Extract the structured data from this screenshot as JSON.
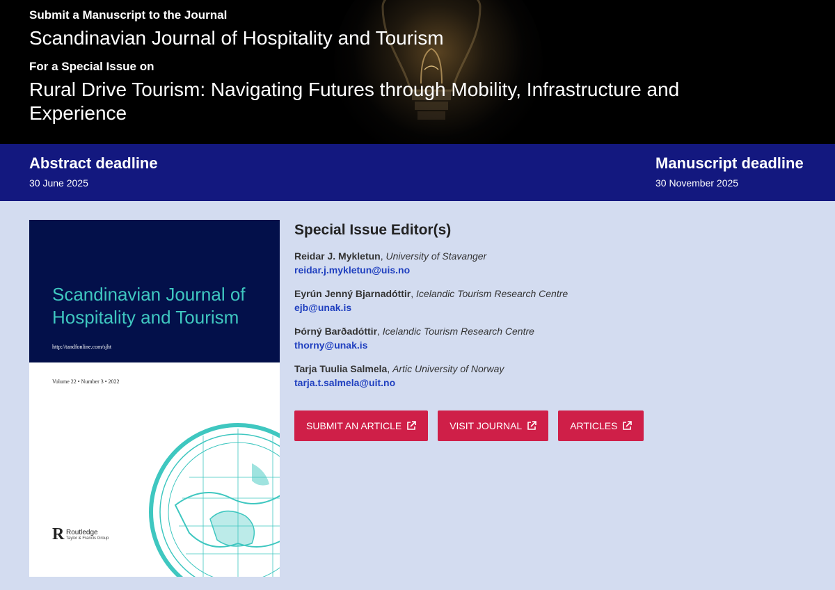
{
  "hero": {
    "kicker": "Submit a Manuscript to the Journal",
    "journal": "Scandinavian Journal of Hospitality and Tourism",
    "special_issue_label": "For a Special Issue on",
    "issue_title": "Rural Drive Tourism: Navigating Futures through Mobility, Infrastructure and Experience"
  },
  "deadlines": {
    "abstract": {
      "label": "Abstract deadline",
      "date": "30 June 2025"
    },
    "manuscript": {
      "label": "Manuscript deadline",
      "date": "30 November 2025"
    }
  },
  "cover": {
    "title": "Scandinavian Journal of Hospitality and Tourism",
    "url": "http://tandfonline.com/sjht",
    "volume": "Volume 22 • Number 3 • 2022",
    "publisher": "Routledge",
    "publisher_sub": "Taylor & Francis Group",
    "accent_color": "#3fc7c0",
    "top_color": "#03104a"
  },
  "editors": {
    "heading": "Special Issue Editor(s)",
    "list": [
      {
        "name": "Reidar J. Mykletun",
        "affiliation": "University of Stavanger",
        "email": "reidar.j.mykletun@uis.no"
      },
      {
        "name": "Eyrún Jenný Bjarnadóttir",
        "affiliation": "Icelandic Tourism Research Centre",
        "email": "ejb@unak.is"
      },
      {
        "name": "Þórný Barðadóttir",
        "affiliation": "Icelandic Tourism Research Centre",
        "email": "thorny@unak.is"
      },
      {
        "name": "Tarja Tuulia Salmela",
        "affiliation": "Artic University of Norway",
        "email": "tarja.t.salmela@uit.no"
      }
    ]
  },
  "actions": {
    "submit": "Submit an article",
    "visit": "Visit journal",
    "articles": "Articles",
    "icon": "external-link-icon"
  },
  "colors": {
    "deadline_bar": "#13187f",
    "button": "#cf1f48",
    "link": "#1f3fbf",
    "page_bg": "#d3dcf0"
  }
}
